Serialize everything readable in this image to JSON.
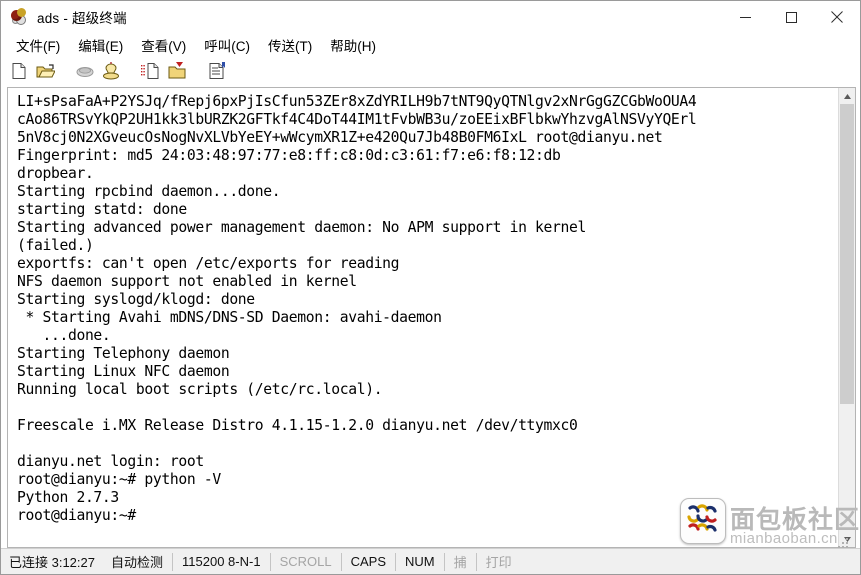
{
  "window": {
    "title": "ads - 超级终端",
    "app_icon": "hyperterminal-icon",
    "controls": {
      "minimize": "minimize-icon",
      "maximize": "maximize-icon",
      "close": "close-icon"
    }
  },
  "menu": {
    "items": [
      {
        "label": "文件(F)",
        "name": "menu-file"
      },
      {
        "label": "编辑(E)",
        "name": "menu-edit"
      },
      {
        "label": "查看(V)",
        "name": "menu-view"
      },
      {
        "label": "呼叫(C)",
        "name": "menu-call"
      },
      {
        "label": "传送(T)",
        "name": "menu-transfer"
      },
      {
        "label": "帮助(H)",
        "name": "menu-help"
      }
    ]
  },
  "toolbar": {
    "buttons": [
      {
        "name": "new-connection-icon",
        "tooltip": "新建连接"
      },
      {
        "name": "open-icon",
        "tooltip": "打开"
      },
      {
        "name": "disconnect-icon",
        "tooltip": "断开"
      },
      {
        "name": "call-icon",
        "tooltip": "呼叫"
      },
      {
        "name": "send-file-icon",
        "tooltip": "发送"
      },
      {
        "name": "receive-file-icon",
        "tooltip": "接收"
      },
      {
        "name": "properties-icon",
        "tooltip": "属性"
      }
    ]
  },
  "terminal": {
    "lines": [
      "LI+sPsaFaA+P2YSJq/fRepj6pxPjIsCfun53ZEr8xZdYRILH9b7tNT9QyQTNlgv2xNrGgGZCGbWoOUA4",
      "cAo86TRSvYkQP2UH1kk3lbURZK2GFTkf4C4DoT44IM1tFvbWB3u/zoEEixBFlbkwYhzvgAlNSVyYQErl",
      "5nV8cj0N2XGveucOsNogNvXLVbYeEY+wWcymXR1Z+e420Qu7Jb48B0FM6IxL root@dianyu.net",
      "Fingerprint: md5 24:03:48:97:77:e8:ff:c8:0d:c3:61:f7:e6:f8:12:db",
      "dropbear.",
      "Starting rpcbind daemon...done.",
      "starting statd: done",
      "Starting advanced power management daemon: No APM support in kernel",
      "(failed.)",
      "exportfs: can't open /etc/exports for reading",
      "NFS daemon support not enabled in kernel",
      "Starting syslogd/klogd: done",
      " * Starting Avahi mDNS/DNS-SD Daemon: avahi-daemon",
      "   ...done.",
      "Starting Telephony daemon",
      "Starting Linux NFC daemon",
      "Running local boot scripts (/etc/rc.local).",
      "",
      "Freescale i.MX Release Distro 4.1.15-1.2.0 dianyu.net /dev/ttymxc0",
      "",
      "dianyu.net login: root",
      "root@dianyu:~# python -V",
      "Python 2.7.3",
      "root@dianyu:~#"
    ]
  },
  "statusbar": {
    "connection": "已连接 3:12:27",
    "detect": "自动检测",
    "line_settings": "115200 8-N-1",
    "scroll": "SCROLL",
    "caps": "CAPS",
    "num": "NUM",
    "capture": "捕",
    "print": "打印"
  },
  "watermark": {
    "title": "面包板社区",
    "domain": "mianbaoban.cn",
    "logo": "mianbaoban-logo-icon"
  },
  "colors": {
    "text": "#000000",
    "window_bg": "#ffffff",
    "statusbar_bg": "#f0f0f0",
    "scrollbar_thumb": "#cdcdcd",
    "watermark": "#b9b9b9"
  }
}
